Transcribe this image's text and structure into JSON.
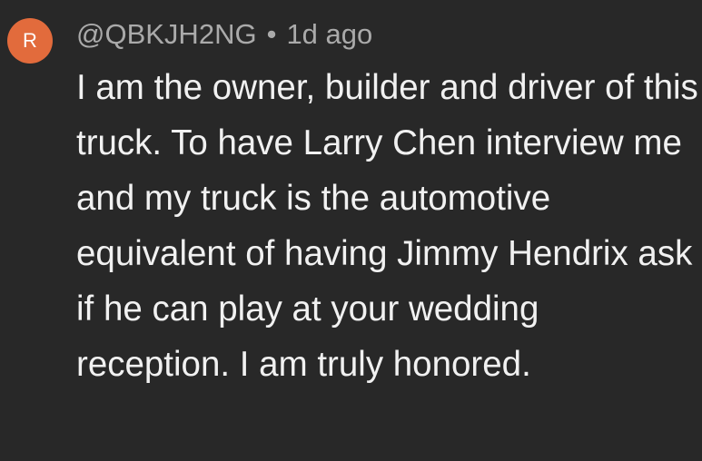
{
  "comment": {
    "avatar_letter": "R",
    "avatar_color": "#e26b3c",
    "author": "@QBKJH2NG",
    "separator": "•",
    "timestamp": "1d ago",
    "text": "I am the owner, builder and driver of this truck. To have Larry Chen interview me and my truck is the automotive equivalent of having Jimmy Hendrix ask if he can play at your wedding reception. I am truly honored."
  }
}
